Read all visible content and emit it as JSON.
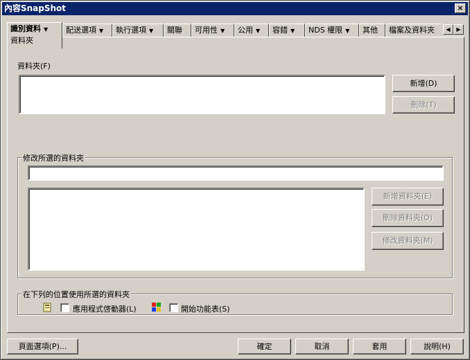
{
  "window": {
    "title": "內容SnapShot",
    "close_label": "×"
  },
  "tabs": {
    "active": {
      "label": "識別資料",
      "sub": "資料夾"
    },
    "items": [
      {
        "label": "配送選項",
        "arrow": "▼"
      },
      {
        "label": "執行選項",
        "arrow": "▼"
      },
      {
        "label": "關聯",
        "arrow": ""
      },
      {
        "label": "可用性",
        "arrow": "▼"
      },
      {
        "label": "公用",
        "arrow": "▼"
      },
      {
        "label": "容錯",
        "arrow": "▼"
      },
      {
        "label": "NDS 權限",
        "arrow": "▼"
      },
      {
        "label": "其他",
        "arrow": ""
      },
      {
        "label": "檔案及資料夾",
        "arrow": ""
      }
    ],
    "active_arrow": "▼",
    "scroll_left": "◀",
    "scroll_right": "▶"
  },
  "folders": {
    "label": "資料夾(F)",
    "add_button": "新增(D)",
    "delete_button": "刪除(T)"
  },
  "modify": {
    "group_title": "修改所選的資料夾",
    "input_value": "",
    "add_folder_button": "新增資料夾(E)",
    "delete_folder_button": "刪除資料夾(O)",
    "modify_folder_button": "修改資料夾(M)"
  },
  "usage": {
    "group_title": "在下列的位置使用所選的資料夾",
    "app_launcher_label": "應用程式啓動器(L)",
    "start_menu_label": "開始功能表(S)"
  },
  "footer": {
    "page_options_button": "頁面選項(P)...",
    "ok_button": "確定",
    "cancel_button": "取消",
    "apply_button": "套用",
    "help_button": "說明(H)"
  }
}
